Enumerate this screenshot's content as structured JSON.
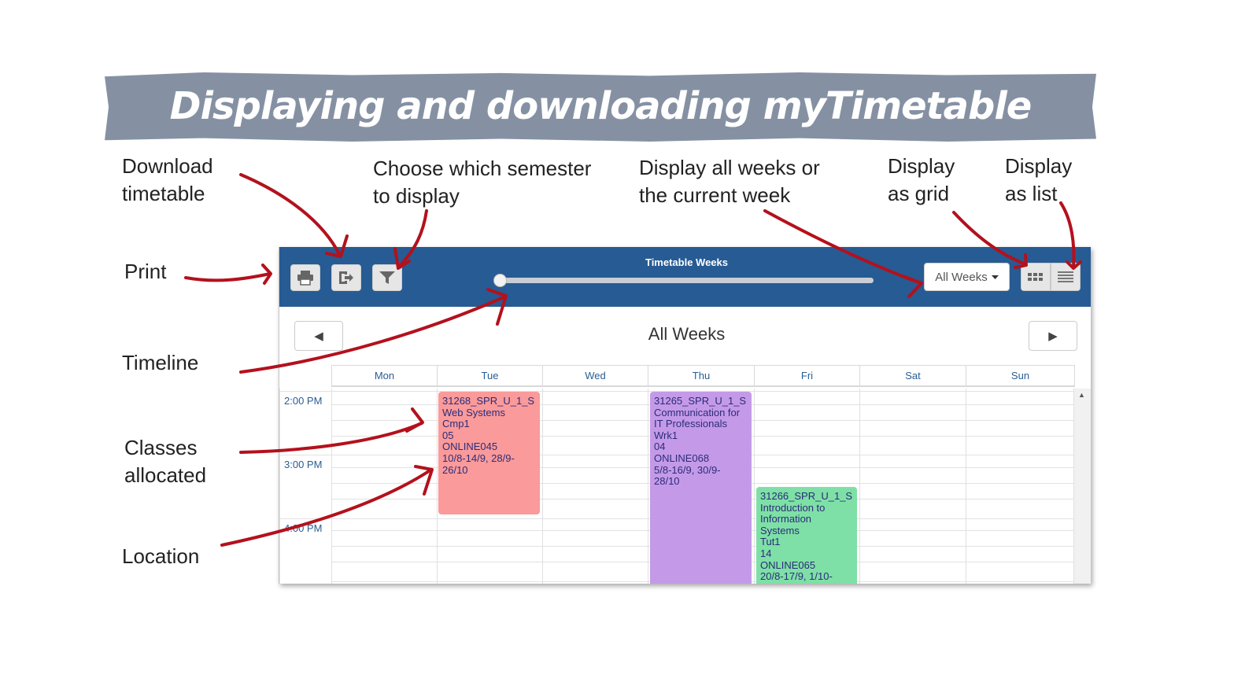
{
  "banner": {
    "title": "Displaying and downloading myTimetable"
  },
  "annotations": {
    "download": "Download\ntimetable",
    "semester": "Choose which  semester\nto display",
    "weeks": "Display all weeks or\nthe current week",
    "grid": "Display\nas grid",
    "list": "Display\nas list",
    "print": "Print",
    "timeline": "Timeline",
    "classes": "Classes\nallocated",
    "location": "Location"
  },
  "toolbar": {
    "title": "Timetable Weeks",
    "weeks_select": "All Weeks",
    "timeline_position": 0
  },
  "week_nav": {
    "heading": "All Weeks",
    "prev": "◀",
    "next": "▶"
  },
  "days": [
    "Mon",
    "Tue",
    "Wed",
    "Thu",
    "Fri",
    "Sat",
    "Sun"
  ],
  "times": [
    "2:00 PM",
    "3:00 PM",
    "4:00 PM"
  ],
  "events": [
    {
      "day": "Tue",
      "color": "#fa9a9a",
      "lines": [
        "31268_SPR_U_1_S",
        "Web Systems",
        "Cmp1",
        "05",
        "ONLINE045",
        "10/8-14/9, 28/9-",
        "26/10"
      ]
    },
    {
      "day": "Thu",
      "color": "#c49ae8",
      "lines": [
        "31265_SPR_U_1_S",
        "Communication for",
        "IT Professionals",
        "Wrk1",
        "04",
        "ONLINE068",
        "5/8-16/9, 30/9-",
        "28/10"
      ]
    },
    {
      "day": "Fri",
      "color": "#7ee0a6",
      "lines": [
        "31266_SPR_U_1_S",
        "Introduction to",
        "Information",
        "Systems",
        "Tut1",
        "14",
        "ONLINE065",
        "20/8-17/9, 1/10-"
      ]
    }
  ],
  "colors": {
    "banner": "#8591a3",
    "toolbar": "#275b93",
    "arrow": "#b3111d",
    "header_text": "#2a5d95"
  }
}
